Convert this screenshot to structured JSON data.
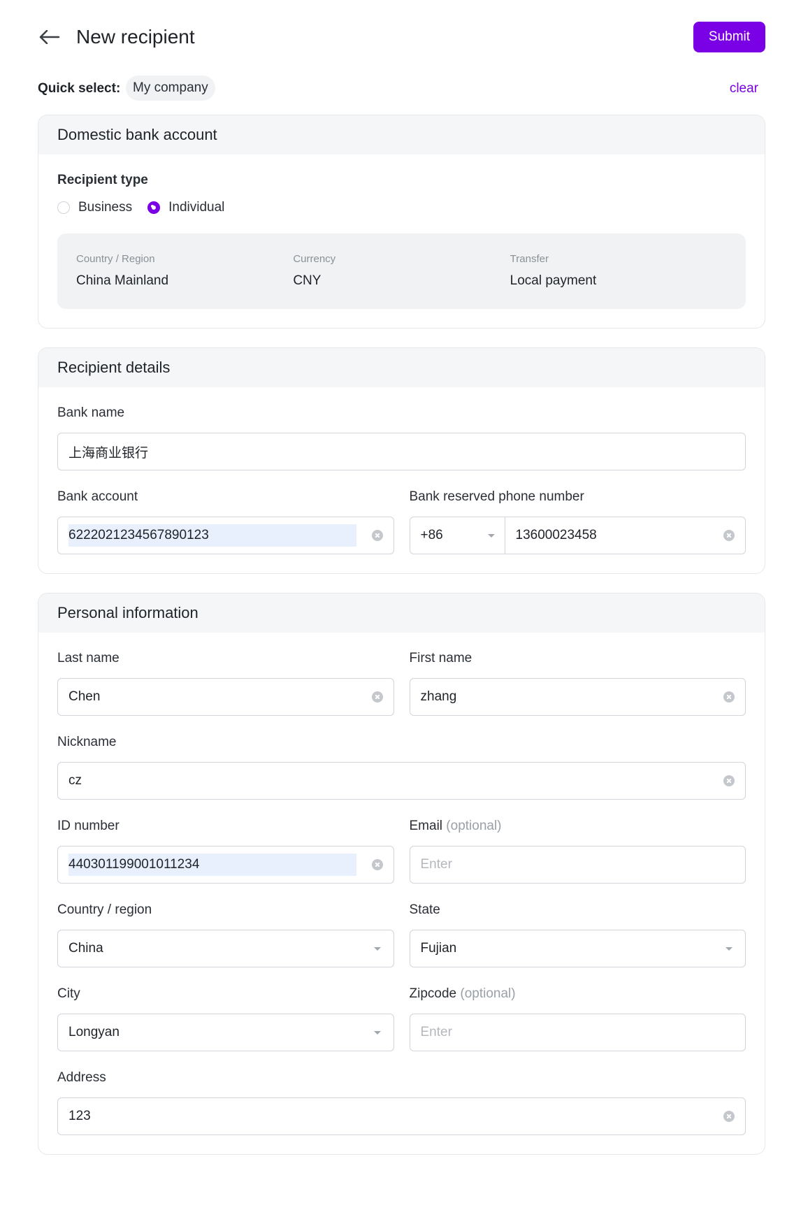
{
  "header": {
    "title": "New recipient",
    "submit_label": "Submit"
  },
  "quick_select": {
    "label": "Quick select:",
    "chip": "My company",
    "clear_label": "clear"
  },
  "domestic": {
    "title": "Domestic bank account",
    "recipient_type_label": "Recipient type",
    "options": [
      "Business",
      "Individual"
    ],
    "selected": "Individual",
    "summary": [
      {
        "key": "Country / Region",
        "value": "China Mainland"
      },
      {
        "key": "Currency",
        "value": "CNY"
      },
      {
        "key": "Transfer",
        "value": "Local payment"
      }
    ]
  },
  "recipient_details": {
    "title": "Recipient details",
    "bank_name_label": "Bank name",
    "bank_name_value": "上海商业银行",
    "bank_account_label": "Bank account",
    "bank_account_value": "6222021234567890123",
    "phone_label": "Bank reserved phone number",
    "phone_code": "+86",
    "phone_number": "13600023458"
  },
  "personal": {
    "title": "Personal information",
    "last_name_label": "Last name",
    "last_name_value": "Chen",
    "first_name_label": "First name",
    "first_name_value": "zhang",
    "nickname_label": "Nickname",
    "nickname_value": "cz",
    "id_label": "ID number",
    "id_value": "440301199001011234",
    "email_label": "Email",
    "email_optional": "(optional)",
    "email_placeholder": "Enter",
    "country_label": "Country / region",
    "country_value": "China",
    "state_label": "State",
    "state_value": "Fujian",
    "city_label": "City",
    "city_value": "Longyan",
    "zip_label": "Zipcode",
    "zip_optional": "(optional)",
    "zip_placeholder": "Enter",
    "address_label": "Address",
    "address_value": "123"
  },
  "colors": {
    "accent": "#7a00e6",
    "section_header_bg": "#f5f6f7",
    "summary_bg": "#f1f2f4",
    "selection_highlight": "#e8f0fe"
  },
  "icons": {
    "back": "arrow-left-icon",
    "clear": "clear-circle-icon",
    "dropdown": "caret-down-icon"
  }
}
